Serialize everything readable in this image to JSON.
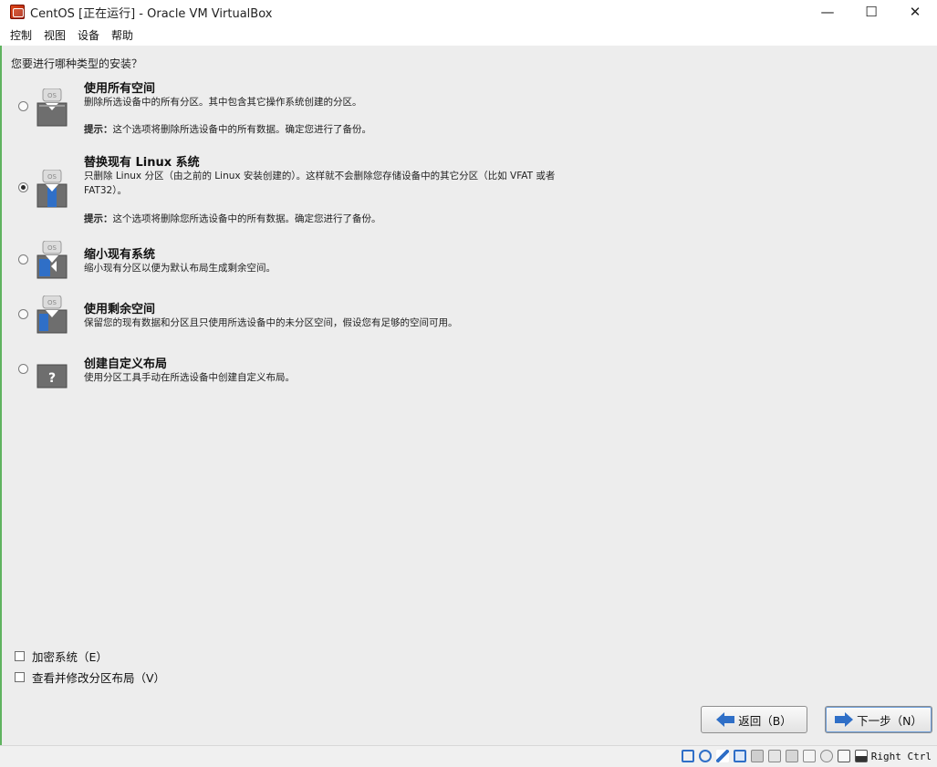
{
  "window": {
    "title": "CentOS [正在运行] - Oracle VM VirtualBox",
    "minimize": "—",
    "maximize": "☐",
    "close": "✕"
  },
  "menu": [
    "控制",
    "视图",
    "设备",
    "帮助"
  ],
  "installer": {
    "question": "您要进行哪种类型的安装？",
    "options": [
      {
        "title": "使用所有空间",
        "desc": "删除所选设备中的所有分区。其中包含其它操作系统创建的分区。",
        "hint_label": "提示：",
        "hint": "这个选项将删除所选设备中的所有数据。确定您进行了备份。",
        "icon": "os-disk-full-icon",
        "checked": false
      },
      {
        "title": "替换现有 Linux 系统",
        "desc": "只删除 Linux 分区（由之前的 Linux 安装创建的）。这样就不会删除您存储设备中的其它分区（比如 VFAT 或者 FAT32）。",
        "hint_label": "提示：",
        "hint": "这个选项将删除您所选设备中的所有数据。确定您进行了备份。",
        "icon": "os-disk-replace-icon",
        "checked": true
      },
      {
        "title": "缩小现有系统",
        "desc": "缩小现有分区以便为默认布局生成剩余空间。",
        "icon": "os-disk-shrink-icon",
        "checked": false
      },
      {
        "title": "使用剩余空间",
        "desc": "保留您的现有数据和分区且只使用所选设备中的未分区空间，假设您有足够的空间可用。",
        "icon": "os-disk-free-space-icon",
        "checked": false
      },
      {
        "title": "创建自定义布局",
        "desc": "使用分区工具手动在所选设备中创建自定义布局。",
        "icon": "question-disk-icon",
        "checked": false
      }
    ],
    "encrypt_label": "加密系统（E）",
    "review_label": "查看并修改分区布局（V）",
    "back_label": "返回（B）",
    "next_label": "下一步（N）"
  },
  "statusbar": {
    "host_key": "Right Ctrl"
  },
  "colors": {
    "screen_bg": "#ededed",
    "arrow_blue": "#2f6fc7",
    "accent_green": "#5fb35f"
  }
}
